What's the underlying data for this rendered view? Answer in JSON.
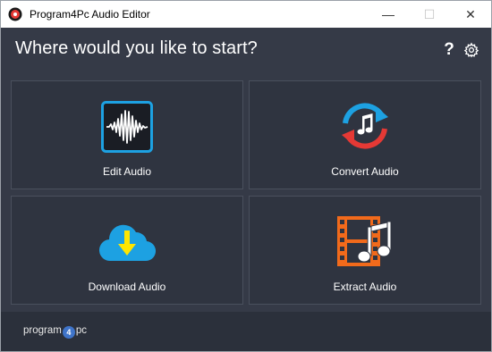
{
  "window": {
    "title": "Program4Pc Audio Editor",
    "minimize_glyph": "—",
    "maximize_glyph": "☐",
    "close_glyph": "✕"
  },
  "main": {
    "heading": "Where would you like to start?",
    "help_glyph": "?",
    "tiles": [
      {
        "label": "Edit Audio",
        "icon": "waveform-icon"
      },
      {
        "label": "Convert Audio",
        "icon": "convert-music-icon"
      },
      {
        "label": "Download Audio",
        "icon": "cloud-download-icon"
      },
      {
        "label": "Extract Audio",
        "icon": "film-music-icon"
      }
    ]
  },
  "footer": {
    "brand_pre": "program",
    "brand_num": "4",
    "brand_post": "pc"
  },
  "colors": {
    "panel": "#353a47",
    "tile": "#2f3440",
    "accent_blue": "#1da1e2",
    "accent_red": "#e53935",
    "accent_orange": "#f26a1b",
    "accent_yellow": "#ffe600"
  }
}
